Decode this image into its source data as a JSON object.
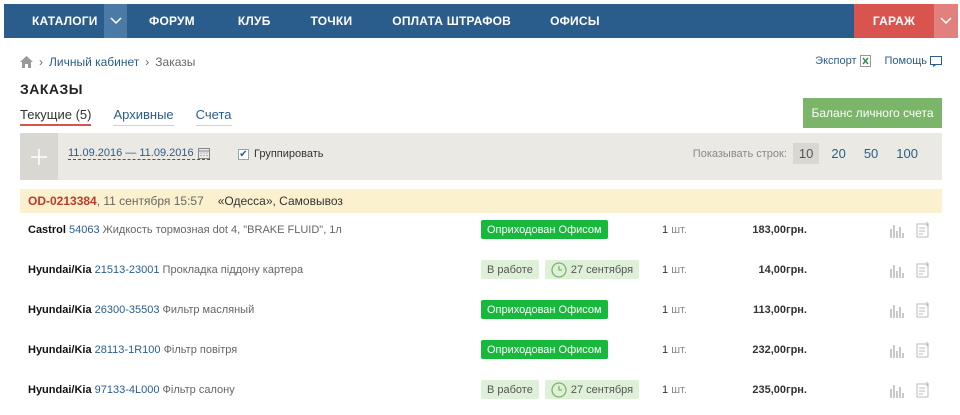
{
  "nav": {
    "items": [
      "КАТАЛОГИ",
      "ФОРУМ",
      "КЛУБ",
      "ТОЧКИ",
      "ОПЛАТА ШТРАФОВ",
      "ОФИСЫ"
    ],
    "garage": "ГАРАЖ"
  },
  "breadcrumb": {
    "link": "Личный кабинет",
    "current": "Заказы"
  },
  "toplinks": {
    "export": "Экспорт",
    "help": "Помощь"
  },
  "title": "ЗАКАЗЫ",
  "tabs": [
    "Текущие (5)",
    "Архивные",
    "Счета"
  ],
  "balance_button": "Баланс личного счета",
  "filter": {
    "date_range": "11.09.2016 — 11.09.2016",
    "group_label": "Группировать",
    "group_checked": true,
    "rows_label": "Показывать строк:",
    "rows_options": [
      "10",
      "20",
      "50",
      "100"
    ],
    "rows_selected": "10"
  },
  "order": {
    "id": "OD-0213384",
    "date": ", 11 сентября 15:57",
    "delivery": "«Одесса», Самовывоз"
  },
  "items": [
    {
      "brand": "Castrol",
      "code": "54063",
      "name": "Жидкость тормозная dot 4, \"BRAKE FLUID\", 1л",
      "status": "Оприходован Офисом",
      "status_type": "green",
      "eta": "",
      "qty": "1",
      "unit": "шт.",
      "price": "183,00грн."
    },
    {
      "brand": "Hyundai/Kia",
      "code": "21513-23001",
      "name": "Прокладка піддону картера",
      "status": "В работе",
      "status_type": "light",
      "eta": "27 сентября",
      "qty": "1",
      "unit": "шт.",
      "price": "14,00грн."
    },
    {
      "brand": "Hyundai/Kia",
      "code": "26300-35503",
      "name": "Фильтр масляный",
      "status": "Оприходован Офисом",
      "status_type": "green",
      "eta": "",
      "qty": "1",
      "unit": "шт.",
      "price": "113,00грн."
    },
    {
      "brand": "Hyundai/Kia",
      "code": "28113-1R100",
      "name": "Фільтр повітря",
      "status": "Оприходован Офисом",
      "status_type": "green",
      "eta": "",
      "qty": "1",
      "unit": "шт.",
      "price": "232,00грн."
    },
    {
      "brand": "Hyundai/Kia",
      "code": "97133-4L000",
      "name": "Фільтр салону",
      "status": "В работе",
      "status_type": "light",
      "eta": "27 сентября",
      "qty": "1",
      "unit": "шт.",
      "price": "235,00грн."
    }
  ]
}
